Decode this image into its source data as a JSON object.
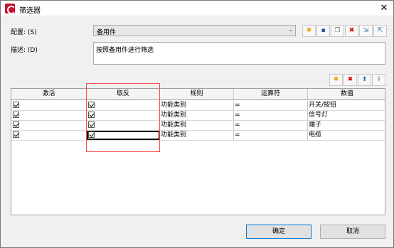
{
  "window": {
    "title": "筛选器",
    "close_glyph": "✕"
  },
  "form": {
    "config_label": "配置: (S)",
    "config_value": "备用件",
    "desc_label": "描述: (D)",
    "desc_value": "按照备用件进行筛选"
  },
  "toolbar_icons": [
    "new-icon",
    "save-icon",
    "copy-icon",
    "delete-icon",
    "import-icon",
    "export-icon"
  ],
  "grid_toolbar_icons": [
    "new-row-icon",
    "delete-row-icon",
    "move-up-icon",
    "move-down-icon"
  ],
  "grid": {
    "columns": [
      "激活",
      "取反",
      "规则",
      "运算符",
      "数值"
    ],
    "rows": [
      {
        "active": true,
        "invert": true,
        "rule": "功能类别",
        "op": "=",
        "value": "开关/按钮"
      },
      {
        "active": true,
        "invert": true,
        "rule": "功能类别",
        "op": "=",
        "value": "信号灯"
      },
      {
        "active": true,
        "invert": true,
        "rule": "功能类别",
        "op": "=",
        "value": "端子"
      },
      {
        "active": true,
        "invert": true,
        "rule": "功能类别",
        "op": "=",
        "value": "电缆"
      }
    ]
  },
  "buttons": {
    "ok": "确定",
    "cancel": "取消"
  },
  "colors": {
    "highlight": "#ff4d4d",
    "brand": "#c8102e",
    "primary_border": "#0078d7"
  }
}
